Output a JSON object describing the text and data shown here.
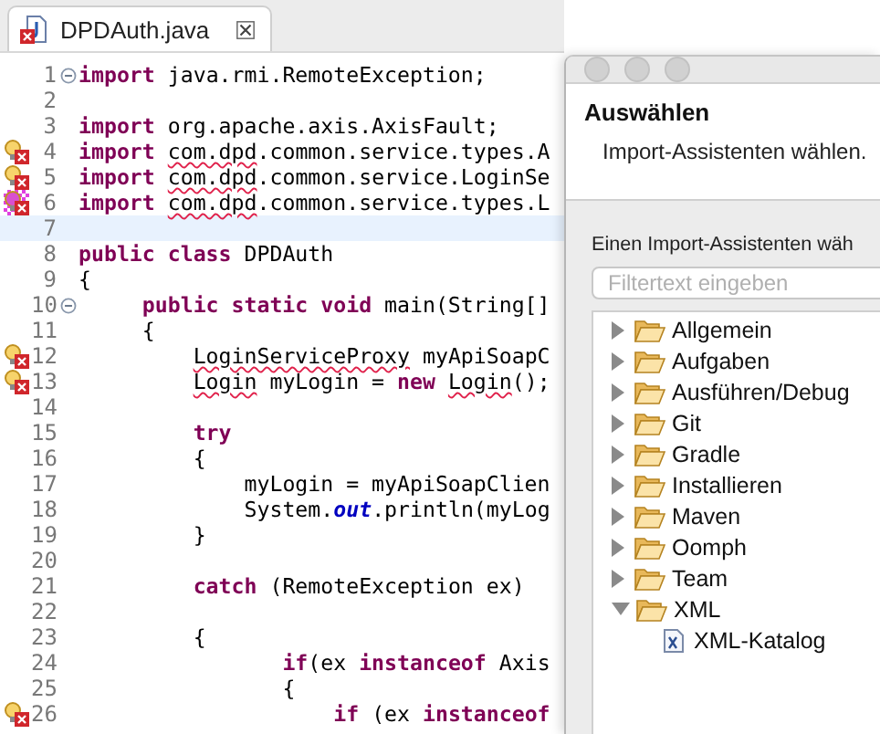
{
  "editor": {
    "tab": {
      "title": "DPDAuth.java",
      "selected": true
    },
    "lines": [
      {
        "number": "1",
        "error": false,
        "foldable": true,
        "current": false,
        "tokens": [
          {
            "kind": "keyword",
            "text": "import"
          },
          {
            "kind": "plain",
            "text": " java.rmi.RemoteException;"
          }
        ]
      },
      {
        "number": "2",
        "error": false,
        "foldable": false,
        "current": false
      },
      {
        "number": "3",
        "error": false,
        "foldable": false,
        "current": false,
        "tokens": [
          {
            "kind": "keyword",
            "text": "import"
          },
          {
            "kind": "plain",
            "text": " org.apache.axis.AxisFault;"
          }
        ]
      },
      {
        "number": "4",
        "error": true,
        "marker_selected": false,
        "foldable": false,
        "current": false,
        "tokens": [
          {
            "kind": "keyword",
            "text": "import "
          },
          {
            "kind": "error",
            "text": "com.dpd"
          },
          {
            "kind": "plain",
            "text": ".common.service.types.A"
          }
        ]
      },
      {
        "number": "5",
        "error": true,
        "marker_selected": false,
        "foldable": false,
        "current": false,
        "tokens": [
          {
            "kind": "keyword",
            "text": "import "
          },
          {
            "kind": "error",
            "text": "com.dpd"
          },
          {
            "kind": "plain",
            "text": ".common.service.LoginSe"
          }
        ]
      },
      {
        "number": "6",
        "error": true,
        "marker_selected": true,
        "foldable": false,
        "current": false,
        "tokens": [
          {
            "kind": "keyword",
            "text": "import "
          },
          {
            "kind": "error",
            "text": "com.dpd"
          },
          {
            "kind": "plain",
            "text": ".common.service.types.L"
          }
        ]
      },
      {
        "number": "7",
        "error": false,
        "foldable": false,
        "current": true
      },
      {
        "number": "8",
        "error": false,
        "foldable": false,
        "current": false,
        "tokens": [
          {
            "kind": "keyword",
            "text": "public class"
          },
          {
            "kind": "plain",
            "text": " DPDAuth"
          }
        ]
      },
      {
        "number": "9",
        "error": false,
        "foldable": false,
        "current": false,
        "tokens": [
          {
            "kind": "plain",
            "text": "{"
          }
        ]
      },
      {
        "number": "10",
        "error": false,
        "foldable": true,
        "current": false,
        "tokens": [
          {
            "kind": "keyword",
            "text": "     public static void"
          },
          {
            "kind": "plain",
            "text": " main(String[]"
          }
        ]
      },
      {
        "number": "11",
        "error": false,
        "foldable": false,
        "current": false,
        "tokens": [
          {
            "kind": "plain",
            "text": "     {"
          }
        ]
      },
      {
        "number": "12",
        "error": true,
        "marker_selected": false,
        "foldable": false,
        "current": false,
        "tokens": [
          {
            "kind": "error",
            "text": "         LoginServiceProxy"
          },
          {
            "kind": "plain",
            "text": " myApiSoapC"
          }
        ]
      },
      {
        "number": "13",
        "error": true,
        "marker_selected": false,
        "foldable": false,
        "current": false,
        "tokens": [
          {
            "kind": "error",
            "text": "         Login"
          },
          {
            "kind": "plain",
            "text": " myLogin = "
          },
          {
            "kind": "keyword",
            "text": "new "
          },
          {
            "kind": "error",
            "text": "Login"
          },
          {
            "kind": "plain",
            "text": "();"
          }
        ]
      },
      {
        "number": "14",
        "error": false,
        "foldable": false,
        "current": false
      },
      {
        "number": "15",
        "error": false,
        "foldable": false,
        "current": false,
        "tokens": [
          {
            "kind": "keyword",
            "text": "         try"
          }
        ]
      },
      {
        "number": "16",
        "error": false,
        "foldable": false,
        "current": false,
        "tokens": [
          {
            "kind": "plain",
            "text": "         {"
          }
        ]
      },
      {
        "number": "17",
        "error": false,
        "foldable": false,
        "current": false,
        "tokens": [
          {
            "kind": "plain",
            "text": "             myLogin = myApiSoapClien"
          }
        ]
      },
      {
        "number": "18",
        "error": false,
        "foldable": false,
        "current": false,
        "tokens": [
          {
            "kind": "plain",
            "text": "             System."
          },
          {
            "kind": "static",
            "text": "out"
          },
          {
            "kind": "plain",
            "text": ".println(myLog"
          }
        ]
      },
      {
        "number": "19",
        "error": false,
        "foldable": false,
        "current": false,
        "tokens": [
          {
            "kind": "plain",
            "text": "         }"
          }
        ]
      },
      {
        "number": "20",
        "error": false,
        "foldable": false,
        "current": false
      },
      {
        "number": "21",
        "error": false,
        "foldable": false,
        "current": false,
        "tokens": [
          {
            "kind": "keyword",
            "text": "         catch"
          },
          {
            "kind": "plain",
            "text": " (RemoteException ex)"
          }
        ]
      },
      {
        "number": "22",
        "error": false,
        "foldable": false,
        "current": false
      },
      {
        "number": "23",
        "error": false,
        "foldable": false,
        "current": false,
        "tokens": [
          {
            "kind": "plain",
            "text": "         {"
          }
        ]
      },
      {
        "number": "24",
        "error": false,
        "foldable": false,
        "current": false,
        "tokens": [
          {
            "kind": "keyword",
            "text": "                if"
          },
          {
            "kind": "plain",
            "text": "(ex "
          },
          {
            "kind": "keyword",
            "text": "instanceof"
          },
          {
            "kind": "plain",
            "text": " Axis"
          }
        ]
      },
      {
        "number": "25",
        "error": false,
        "foldable": false,
        "current": false,
        "tokens": [
          {
            "kind": "plain",
            "text": "                {"
          }
        ]
      },
      {
        "number": "26",
        "error": true,
        "marker_selected": false,
        "foldable": false,
        "current": false,
        "tokens": [
          {
            "kind": "keyword",
            "text": "                    if"
          },
          {
            "kind": "plain",
            "text": " (ex "
          },
          {
            "kind": "keyword",
            "text": "instanceof"
          }
        ]
      }
    ]
  },
  "dialog": {
    "heading": "Auswählen",
    "description": "Import-Assistenten wählen.",
    "prompt": "Einen Import-Assistenten wäh",
    "filter": {
      "placeholder": "Filtertext eingeben"
    },
    "tree": [
      {
        "label": "Allgemein",
        "expanded": false
      },
      {
        "label": "Aufgaben",
        "expanded": false
      },
      {
        "label": "Ausführen/Debug",
        "expanded": false
      },
      {
        "label": "Git",
        "expanded": false
      },
      {
        "label": "Gradle",
        "expanded": false
      },
      {
        "label": "Installieren",
        "expanded": false
      },
      {
        "label": "Maven",
        "expanded": false
      },
      {
        "label": "Oomph",
        "expanded": false
      },
      {
        "label": "Team",
        "expanded": false
      },
      {
        "label": "XML",
        "expanded": true,
        "children": [
          {
            "label": "XML-Katalog"
          }
        ]
      }
    ]
  }
}
